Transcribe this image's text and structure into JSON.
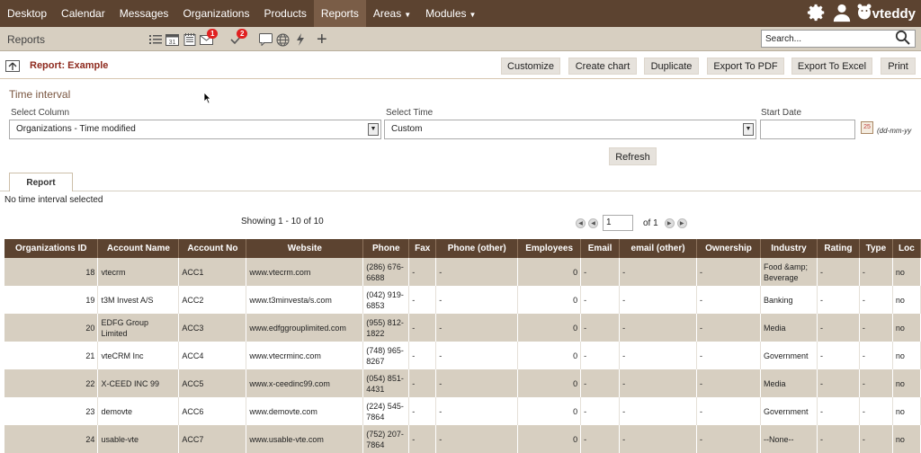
{
  "topnav": {
    "items": [
      {
        "label": "Desktop"
      },
      {
        "label": "Calendar"
      },
      {
        "label": "Messages"
      },
      {
        "label": "Organizations"
      },
      {
        "label": "Products"
      },
      {
        "label": "Reports",
        "active": true
      },
      {
        "label": "Areas",
        "dropdown": true
      },
      {
        "label": "Modules",
        "dropdown": true
      }
    ],
    "logo_text": "vteddy",
    "icons": [
      "gear-icon",
      "user-icon"
    ]
  },
  "subbar": {
    "title": "Reports",
    "icons": [
      "list-icon",
      "calendar-icon",
      "notebook-icon",
      "mail-icon",
      "check-icon",
      "chat-icon",
      "globe-icon",
      "bolt-icon",
      "plus-icon"
    ],
    "mail_badge": "1",
    "check_badge": "2",
    "search_placeholder": "Search..."
  },
  "report_header": {
    "title": "Report: Example",
    "buttons": [
      "Customize",
      "Create chart",
      "Duplicate",
      "Export To PDF",
      "Export To Excel",
      "Print"
    ]
  },
  "time_interval": {
    "section_label": "Time interval",
    "select_column_label": "Select Column",
    "select_column_value": "Organizations - Time modified",
    "select_time_label": "Select Time",
    "select_time_value": "Custom",
    "start_date_label": "Start Date",
    "start_date_value": "",
    "date_format": "(dd-mm-yy",
    "calendar_badge": "25",
    "refresh_label": "Refresh"
  },
  "tab": {
    "label": "Report"
  },
  "status": {
    "no_interval": "No time interval selected"
  },
  "pagination": {
    "showing": "Showing 1 - 10 of 10",
    "page": "1",
    "of": "of 1"
  },
  "table": {
    "columns": [
      "Organizations ID",
      "Account Name",
      "Account No",
      "Website",
      "Phone",
      "Fax",
      "Phone (other)",
      "Employees",
      "Email",
      "email (other)",
      "Ownership",
      "Industry",
      "Rating",
      "Type",
      "Loc"
    ],
    "rows": [
      [
        "18",
        "vtecrm",
        "ACC1",
        "www.vtecrm.com",
        "(286) 676-6688",
        "-",
        "-",
        "0",
        "-",
        "-",
        "-",
        "Food &amp; Beverage",
        "-",
        "-",
        "no"
      ],
      [
        "19",
        "t3M Invest A/S",
        "ACC2",
        "www.t3minvesta/s.com",
        "(042) 919-6853",
        "-",
        "-",
        "0",
        "-",
        "-",
        "-",
        "Banking",
        "-",
        "-",
        "no"
      ],
      [
        "20",
        "EDFG Group Limited",
        "ACC3",
        "www.edfggrouplimited.com",
        "(955) 812-1822",
        "-",
        "-",
        "0",
        "-",
        "-",
        "-",
        "Media",
        "-",
        "-",
        "no"
      ],
      [
        "21",
        "vteCRM Inc",
        "ACC4",
        "www.vtecrminc.com",
        "(748) 965-8267",
        "-",
        "-",
        "0",
        "-",
        "-",
        "-",
        "Government",
        "-",
        "-",
        "no"
      ],
      [
        "22",
        "X-CEED INC 99",
        "ACC5",
        "www.x-ceedinc99.com",
        "(054) 851-4431",
        "-",
        "-",
        "0",
        "-",
        "-",
        "-",
        "Media",
        "-",
        "-",
        "no"
      ],
      [
        "23",
        "demovte",
        "ACC6",
        "www.demovte.com",
        "(224) 545-7864",
        "-",
        "-",
        "0",
        "-",
        "-",
        "-",
        "Government",
        "-",
        "-",
        "no"
      ],
      [
        "24",
        "usable-vte",
        "ACC7",
        "www.usable-vte.com",
        "(752) 207-7864",
        "-",
        "-",
        "0",
        "-",
        "-",
        "-",
        "--None--",
        "-",
        "-",
        "no"
      ]
    ]
  }
}
